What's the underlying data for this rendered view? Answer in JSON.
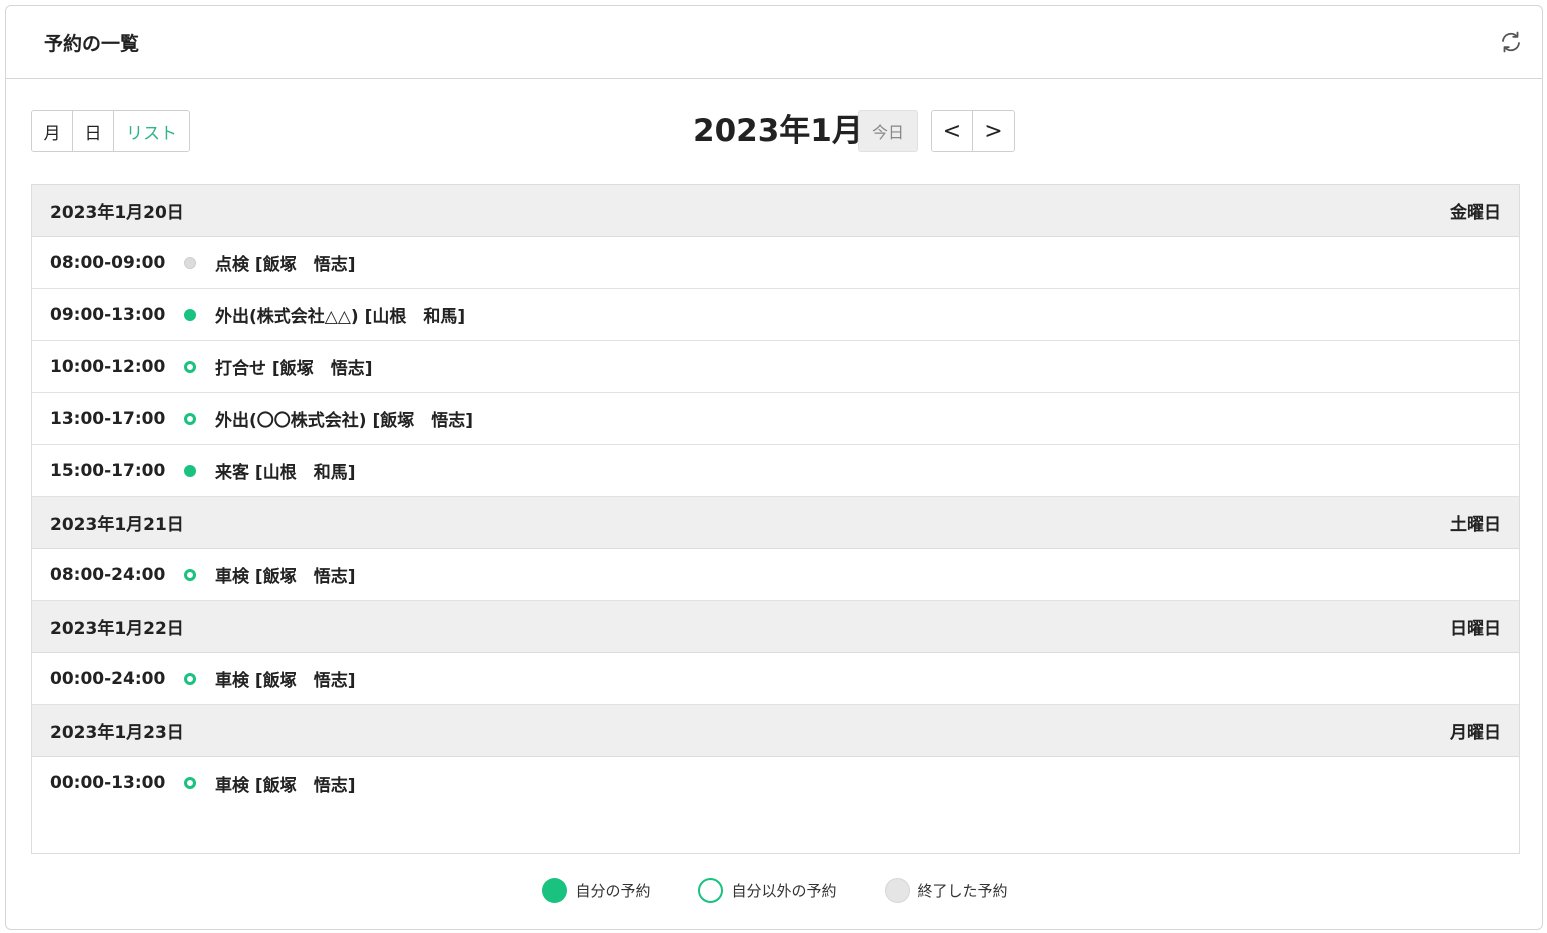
{
  "header": {
    "title": "予約の一覧",
    "refresh_icon": "refresh-icon"
  },
  "toolbar": {
    "views": [
      {
        "label": "月",
        "active": false
      },
      {
        "label": "日",
        "active": false
      },
      {
        "label": "リスト",
        "active": true
      }
    ],
    "period_title": "2023年1月",
    "today_label": "今日",
    "prev_label": "<",
    "next_label": ">"
  },
  "days": [
    {
      "date": "2023年1月20日",
      "weekday": "金曜日",
      "events": [
        {
          "time": "08:00-09:00",
          "status": "done",
          "title": "点検 [飯塚　悟志]"
        },
        {
          "time": "09:00-13:00",
          "status": "own",
          "title": "外出(株式会社△△) [山根　和馬]"
        },
        {
          "time": "10:00-12:00",
          "status": "other",
          "title": "打合せ [飯塚　悟志]"
        },
        {
          "time": "13:00-17:00",
          "status": "other",
          "title": "外出(〇〇株式会社) [飯塚　悟志]"
        },
        {
          "time": "15:00-17:00",
          "status": "own",
          "title": "来客 [山根　和馬]"
        }
      ]
    },
    {
      "date": "2023年1月21日",
      "weekday": "土曜日",
      "events": [
        {
          "time": "08:00-24:00",
          "status": "other",
          "title": "車検 [飯塚　悟志]"
        }
      ]
    },
    {
      "date": "2023年1月22日",
      "weekday": "日曜日",
      "events": [
        {
          "time": "00:00-24:00",
          "status": "other",
          "title": "車検 [飯塚　悟志]"
        }
      ]
    },
    {
      "date": "2023年1月23日",
      "weekday": "月曜日",
      "events": [
        {
          "time": "00:00-13:00",
          "status": "other",
          "title": "車検 [飯塚　悟志]"
        }
      ]
    }
  ],
  "legend": [
    {
      "status": "own",
      "label": "自分の予約"
    },
    {
      "status": "other",
      "label": "自分以外の予約"
    },
    {
      "status": "done",
      "label": "終了した予約"
    }
  ],
  "colors": {
    "accent": "#19c27f",
    "accent_text": "#2fb58c",
    "day_header_bg": "#efefef",
    "done_dot": "#dcdcdc"
  }
}
